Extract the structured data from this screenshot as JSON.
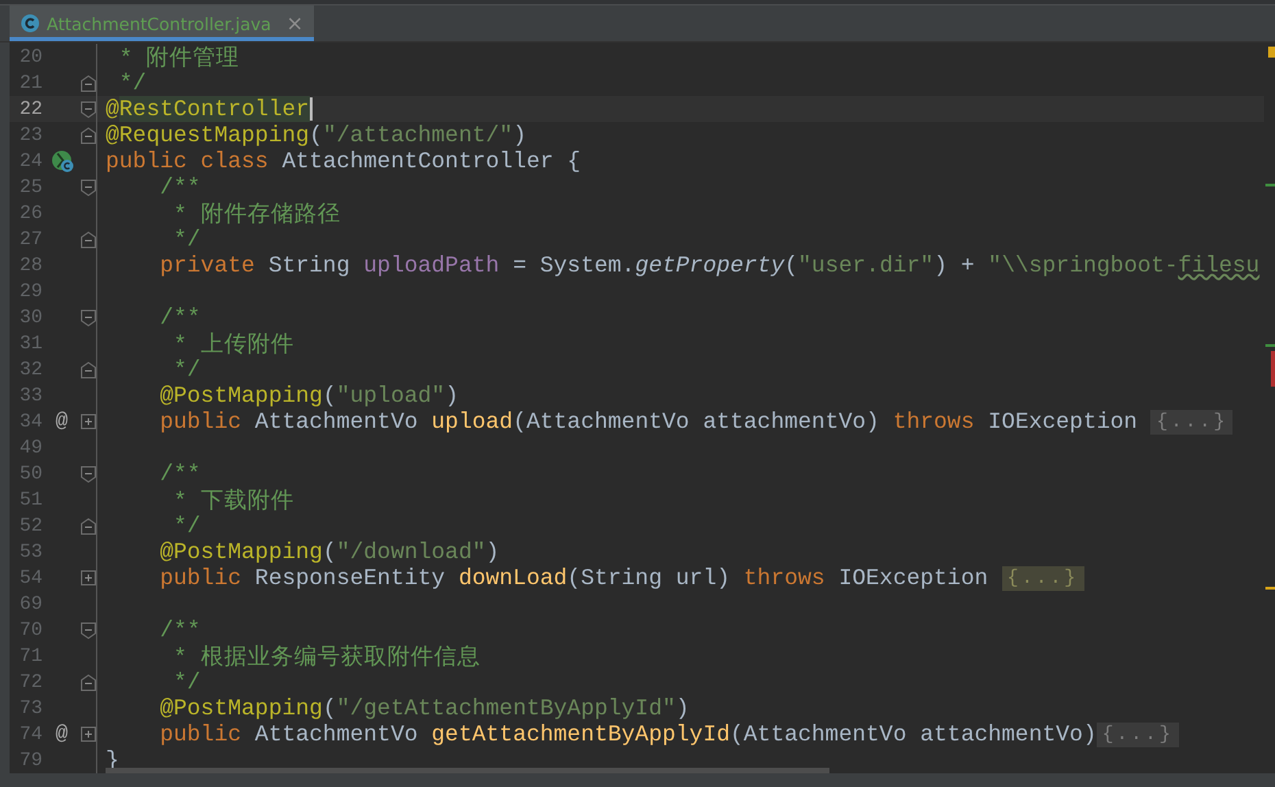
{
  "tabs": [
    {
      "label": "AttachmentController.java",
      "selected": true,
      "close": "×"
    }
  ],
  "lines": [
    {
      "number": "20",
      "current": false,
      "tokens": [
        {
          "kind": "comment",
          "text": " * 附件管理"
        }
      ]
    },
    {
      "number": "21",
      "current": false,
      "fold": {
        "kind": "end"
      },
      "tokens": [
        {
          "kind": "comment",
          "text": " */"
        }
      ]
    },
    {
      "number": "22",
      "current": true,
      "fold": {
        "kind": "start"
      },
      "tokens": [
        {
          "kind": "annotation",
          "text": "@"
        },
        {
          "kind": "annotation-match",
          "text": "RestController"
        }
      ]
    },
    {
      "number": "23",
      "current": false,
      "fold": {
        "kind": "end"
      },
      "tokens": [
        {
          "kind": "annotation",
          "text": "@RequestMapping"
        },
        {
          "kind": "plain",
          "text": "("
        },
        {
          "kind": "string",
          "text": "\"/attachment/\""
        },
        {
          "kind": "plain",
          "text": ")"
        }
      ]
    },
    {
      "number": "24",
      "current": false,
      "gutter_icon": {
        "kind": "class"
      },
      "tokens": [
        {
          "kind": "keyword",
          "text": "public class "
        },
        {
          "kind": "plain",
          "text": "AttachmentController {"
        }
      ]
    },
    {
      "number": "25",
      "current": false,
      "fold": {
        "kind": "start"
      },
      "tokens": [
        {
          "kind": "comment",
          "text": "    /**"
        }
      ]
    },
    {
      "number": "26",
      "current": false,
      "tokens": [
        {
          "kind": "comment",
          "text": "     * 附件存储路径"
        }
      ]
    },
    {
      "number": "27",
      "current": false,
      "fold": {
        "kind": "end"
      },
      "tokens": [
        {
          "kind": "comment",
          "text": "     */"
        }
      ]
    },
    {
      "number": "28",
      "current": false,
      "tokens": [
        {
          "kind": "keyword",
          "text": "    private "
        },
        {
          "kind": "plain",
          "text": "String "
        },
        {
          "kind": "field",
          "text": "uploadPath"
        },
        {
          "kind": "plain",
          "text": " = System."
        },
        {
          "kind": "static-call",
          "text": "getProperty"
        },
        {
          "kind": "plain",
          "text": "("
        },
        {
          "kind": "string",
          "text": "\"user.dir\""
        },
        {
          "kind": "plain",
          "text": ") + "
        },
        {
          "kind": "string",
          "text": "\"\\\\springboot-"
        },
        {
          "kind": "string-typo",
          "text": "filesu"
        }
      ]
    },
    {
      "number": "29",
      "current": false
    },
    {
      "number": "30",
      "current": false,
      "fold": {
        "kind": "start"
      },
      "tokens": [
        {
          "kind": "comment",
          "text": "    /**"
        }
      ]
    },
    {
      "number": "31",
      "current": false,
      "tokens": [
        {
          "kind": "comment",
          "text": "     * 上传附件"
        }
      ]
    },
    {
      "number": "32",
      "current": false,
      "fold": {
        "kind": "end"
      },
      "tokens": [
        {
          "kind": "comment",
          "text": "     */"
        }
      ]
    },
    {
      "number": "33",
      "current": false,
      "tokens": [
        {
          "kind": "annotation",
          "text": "    @PostMapping"
        },
        {
          "kind": "plain",
          "text": "("
        },
        {
          "kind": "string",
          "text": "\"upload\""
        },
        {
          "kind": "plain",
          "text": ")"
        }
      ]
    },
    {
      "number": "34",
      "current": false,
      "gutter_text": "@",
      "fold": {
        "kind": "collapsed"
      },
      "tokens": [
        {
          "kind": "keyword",
          "text": "    public "
        },
        {
          "kind": "plain",
          "text": "AttachmentVo "
        },
        {
          "kind": "method",
          "text": "upload"
        },
        {
          "kind": "plain",
          "text": "(AttachmentVo attachmentVo) "
        },
        {
          "kind": "keyword",
          "text": "throws "
        },
        {
          "kind": "plain",
          "text": "IOException "
        }
      ],
      "placeholder": {
        "text": "{...}",
        "highlighted": false
      }
    },
    {
      "number": "49",
      "current": false
    },
    {
      "number": "50",
      "current": false,
      "fold": {
        "kind": "start"
      },
      "tokens": [
        {
          "kind": "comment",
          "text": "    /**"
        }
      ]
    },
    {
      "number": "51",
      "current": false,
      "tokens": [
        {
          "kind": "comment",
          "text": "     * 下载附件"
        }
      ]
    },
    {
      "number": "52",
      "current": false,
      "fold": {
        "kind": "end"
      },
      "tokens": [
        {
          "kind": "comment",
          "text": "     */"
        }
      ]
    },
    {
      "number": "53",
      "current": false,
      "tokens": [
        {
          "kind": "annotation",
          "text": "    @PostMapping"
        },
        {
          "kind": "plain",
          "text": "("
        },
        {
          "kind": "string",
          "text": "\"/download\""
        },
        {
          "kind": "plain",
          "text": ")"
        }
      ]
    },
    {
      "number": "54",
      "current": false,
      "fold": {
        "kind": "collapsed"
      },
      "tokens": [
        {
          "kind": "keyword",
          "text": "    public "
        },
        {
          "kind": "plain",
          "text": "ResponseEntity "
        },
        {
          "kind": "method",
          "text": "downLoad"
        },
        {
          "kind": "plain",
          "text": "(String url) "
        },
        {
          "kind": "keyword",
          "text": "throws "
        },
        {
          "kind": "plain",
          "text": "IOException "
        }
      ],
      "placeholder": {
        "text": "{...}",
        "highlighted": true
      }
    },
    {
      "number": "69",
      "current": false
    },
    {
      "number": "70",
      "current": false,
      "fold": {
        "kind": "start"
      },
      "tokens": [
        {
          "kind": "comment",
          "text": "    /**"
        }
      ]
    },
    {
      "number": "71",
      "current": false,
      "tokens": [
        {
          "kind": "comment",
          "text": "     * 根据业务编号获取附件信息"
        }
      ]
    },
    {
      "number": "72",
      "current": false,
      "fold": {
        "kind": "end"
      },
      "tokens": [
        {
          "kind": "comment",
          "text": "     */"
        }
      ]
    },
    {
      "number": "73",
      "current": false,
      "tokens": [
        {
          "kind": "annotation",
          "text": "    @PostMapping"
        },
        {
          "kind": "plain",
          "text": "("
        },
        {
          "kind": "string",
          "text": "\"/getAttachmentByApplyId\""
        },
        {
          "kind": "plain",
          "text": ")"
        }
      ]
    },
    {
      "number": "74",
      "current": false,
      "gutter_text": "@",
      "fold": {
        "kind": "collapsed"
      },
      "tokens": [
        {
          "kind": "keyword",
          "text": "    public "
        },
        {
          "kind": "plain",
          "text": "AttachmentVo "
        },
        {
          "kind": "method",
          "text": "getAttachmentByApplyId"
        },
        {
          "kind": "plain",
          "text": "(AttachmentVo attachmentVo)"
        }
      ],
      "placeholder": {
        "text": "{...}",
        "highlighted": false
      }
    },
    {
      "number": "79",
      "current": false,
      "tokens": [
        {
          "kind": "plain",
          "text": "}"
        }
      ]
    }
  ],
  "stripe_marks": [
    {
      "kind": "warning",
      "color": "#d8a418"
    },
    {
      "kind": "change",
      "color": "#3f8f3f"
    },
    {
      "kind": "change",
      "color": "#3f8f3f"
    },
    {
      "kind": "error",
      "color": "#b03030"
    },
    {
      "kind": "warning",
      "color": "#d8a418"
    }
  ]
}
